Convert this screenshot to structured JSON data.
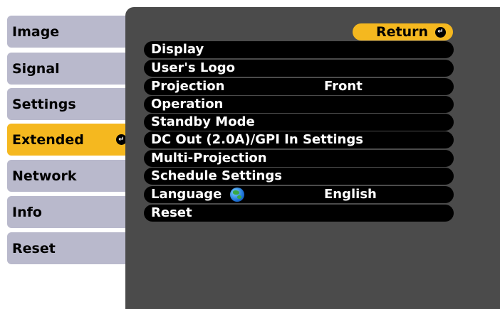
{
  "sidebar": {
    "tabs": [
      {
        "label": "Image"
      },
      {
        "label": "Signal"
      },
      {
        "label": "Settings"
      },
      {
        "label": "Extended",
        "selected": true
      },
      {
        "label": "Network"
      },
      {
        "label": "Info"
      },
      {
        "label": "Reset"
      }
    ]
  },
  "panel": {
    "return_label": "Return",
    "items": [
      {
        "label": "Display",
        "value": ""
      },
      {
        "label": "User's Logo",
        "value": ""
      },
      {
        "label": "Projection",
        "value": "Front"
      },
      {
        "label": "Operation",
        "value": ""
      },
      {
        "label": "Standby Mode",
        "value": ""
      },
      {
        "label": "DC Out (2.0A)/GPI In Settings",
        "value": ""
      },
      {
        "label": "Multi-Projection",
        "value": ""
      },
      {
        "label": "Schedule Settings",
        "value": ""
      },
      {
        "label": "Language",
        "value": "English",
        "icon": "globe-icon"
      },
      {
        "label": "Reset",
        "value": ""
      }
    ]
  },
  "colors": {
    "accent": "#f5b81f",
    "tab_bg": "#b9b9cc",
    "panel_bg": "#4b4b4b",
    "row_bg": "#000000"
  },
  "icons": {
    "enter": "enter-icon",
    "globe": "globe-icon"
  }
}
